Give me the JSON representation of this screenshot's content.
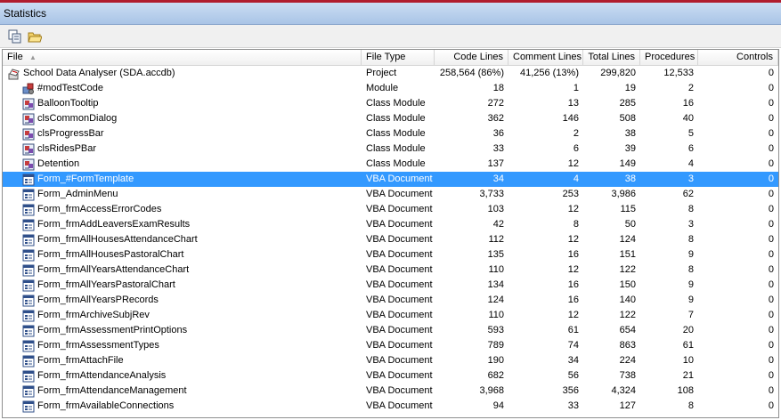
{
  "window": {
    "title": "Statistics"
  },
  "toolbar": {
    "copy_icon": "copy-icon",
    "open_icon": "open-folder-icon"
  },
  "columns": [
    "File",
    "File Type",
    "Code Lines",
    "Comment Lines",
    "Total Lines",
    "Procedures",
    "Controls"
  ],
  "rows": [
    {
      "icon": "project-icon",
      "file": "School Data Analyser (SDA.accdb)",
      "type": "Project",
      "code": "258,564 (86%)",
      "comment": "41,256 (13%)",
      "total": "299,820",
      "procs": "12,533",
      "controls": "0",
      "indent": 0
    },
    {
      "icon": "module-icon",
      "file": "#modTestCode",
      "type": "Module",
      "code": "18",
      "comment": "1",
      "total": "19",
      "procs": "2",
      "controls": "0",
      "indent": 1
    },
    {
      "icon": "class-module-icon",
      "file": "BalloonTooltip",
      "type": "Class Module",
      "code": "272",
      "comment": "13",
      "total": "285",
      "procs": "16",
      "controls": "0",
      "indent": 1
    },
    {
      "icon": "class-module-icon",
      "file": "clsCommonDialog",
      "type": "Class Module",
      "code": "362",
      "comment": "146",
      "total": "508",
      "procs": "40",
      "controls": "0",
      "indent": 1
    },
    {
      "icon": "class-module-icon",
      "file": "clsProgressBar",
      "type": "Class Module",
      "code": "36",
      "comment": "2",
      "total": "38",
      "procs": "5",
      "controls": "0",
      "indent": 1
    },
    {
      "icon": "class-module-icon",
      "file": "clsRidesPBar",
      "type": "Class Module",
      "code": "33",
      "comment": "6",
      "total": "39",
      "procs": "6",
      "controls": "0",
      "indent": 1
    },
    {
      "icon": "class-module-icon",
      "file": "Detention",
      "type": "Class Module",
      "code": "137",
      "comment": "12",
      "total": "149",
      "procs": "4",
      "controls": "0",
      "indent": 1
    },
    {
      "icon": "form-icon",
      "file": "Form_#FormTemplate",
      "type": "VBA Document",
      "code": "34",
      "comment": "4",
      "total": "38",
      "procs": "3",
      "controls": "0",
      "indent": 1,
      "selected": true
    },
    {
      "icon": "form-icon",
      "file": "Form_AdminMenu",
      "type": "VBA Document",
      "code": "3,733",
      "comment": "253",
      "total": "3,986",
      "procs": "62",
      "controls": "0",
      "indent": 1
    },
    {
      "icon": "form-icon",
      "file": "Form_frmAccessErrorCodes",
      "type": "VBA Document",
      "code": "103",
      "comment": "12",
      "total": "115",
      "procs": "8",
      "controls": "0",
      "indent": 1
    },
    {
      "icon": "form-icon",
      "file": "Form_frmAddLeaversExamResults",
      "type": "VBA Document",
      "code": "42",
      "comment": "8",
      "total": "50",
      "procs": "3",
      "controls": "0",
      "indent": 1
    },
    {
      "icon": "form-icon",
      "file": "Form_frmAllHousesAttendanceChart",
      "type": "VBA Document",
      "code": "112",
      "comment": "12",
      "total": "124",
      "procs": "8",
      "controls": "0",
      "indent": 1
    },
    {
      "icon": "form-icon",
      "file": "Form_frmAllHousesPastoralChart",
      "type": "VBA Document",
      "code": "135",
      "comment": "16",
      "total": "151",
      "procs": "9",
      "controls": "0",
      "indent": 1
    },
    {
      "icon": "form-icon",
      "file": "Form_frmAllYearsAttendanceChart",
      "type": "VBA Document",
      "code": "110",
      "comment": "12",
      "total": "122",
      "procs": "8",
      "controls": "0",
      "indent": 1
    },
    {
      "icon": "form-icon",
      "file": "Form_frmAllYearsPastoralChart",
      "type": "VBA Document",
      "code": "134",
      "comment": "16",
      "total": "150",
      "procs": "9",
      "controls": "0",
      "indent": 1
    },
    {
      "icon": "form-icon",
      "file": "Form_frmAllYearsPRecords",
      "type": "VBA Document",
      "code": "124",
      "comment": "16",
      "total": "140",
      "procs": "9",
      "controls": "0",
      "indent": 1
    },
    {
      "icon": "form-icon",
      "file": "Form_frmArchiveSubjRev",
      "type": "VBA Document",
      "code": "110",
      "comment": "12",
      "total": "122",
      "procs": "7",
      "controls": "0",
      "indent": 1
    },
    {
      "icon": "form-icon",
      "file": "Form_frmAssessmentPrintOptions",
      "type": "VBA Document",
      "code": "593",
      "comment": "61",
      "total": "654",
      "procs": "20",
      "controls": "0",
      "indent": 1
    },
    {
      "icon": "form-icon",
      "file": "Form_frmAssessmentTypes",
      "type": "VBA Document",
      "code": "789",
      "comment": "74",
      "total": "863",
      "procs": "61",
      "controls": "0",
      "indent": 1
    },
    {
      "icon": "form-icon",
      "file": "Form_frmAttachFile",
      "type": "VBA Document",
      "code": "190",
      "comment": "34",
      "total": "224",
      "procs": "10",
      "controls": "0",
      "indent": 1
    },
    {
      "icon": "form-icon",
      "file": "Form_frmAttendanceAnalysis",
      "type": "VBA Document",
      "code": "682",
      "comment": "56",
      "total": "738",
      "procs": "21",
      "controls": "0",
      "indent": 1
    },
    {
      "icon": "form-icon",
      "file": "Form_frmAttendanceManagement",
      "type": "VBA Document",
      "code": "3,968",
      "comment": "356",
      "total": "4,324",
      "procs": "108",
      "controls": "0",
      "indent": 1
    },
    {
      "icon": "form-icon",
      "file": "Form_frmAvailableConnections",
      "type": "VBA Document",
      "code": "94",
      "comment": "33",
      "total": "127",
      "procs": "8",
      "controls": "0",
      "indent": 1
    }
  ]
}
